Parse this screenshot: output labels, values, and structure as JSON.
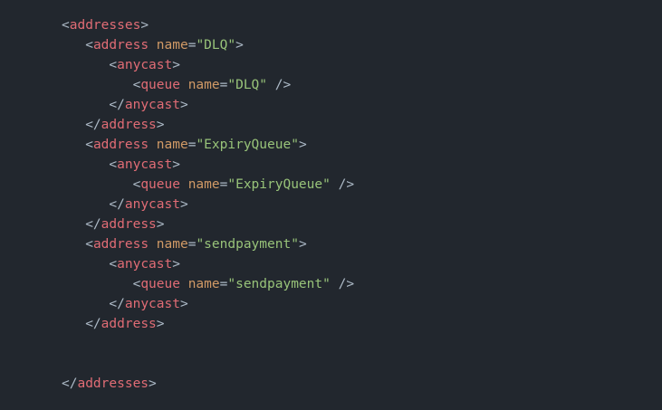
{
  "theme": {
    "background": "#22272e",
    "text": "#adbac7",
    "tag": "#e06c75",
    "attribute": "#d19a66",
    "string": "#98c379"
  },
  "lines": [
    {
      "indent": "",
      "tokens": [
        {
          "t": "<",
          "c": "punct"
        },
        {
          "t": "addresses",
          "c": "tag"
        },
        {
          "t": ">",
          "c": "punct"
        }
      ]
    },
    {
      "indent": "   ",
      "tokens": [
        {
          "t": "<",
          "c": "punct"
        },
        {
          "t": "address",
          "c": "tag"
        },
        {
          "t": " ",
          "c": "punct"
        },
        {
          "t": "name",
          "c": "attr"
        },
        {
          "t": "=",
          "c": "punct"
        },
        {
          "t": "\"DLQ\"",
          "c": "val"
        },
        {
          "t": ">",
          "c": "punct"
        }
      ]
    },
    {
      "indent": "      ",
      "tokens": [
        {
          "t": "<",
          "c": "punct"
        },
        {
          "t": "anycast",
          "c": "tag"
        },
        {
          "t": ">",
          "c": "punct"
        }
      ]
    },
    {
      "indent": "         ",
      "tokens": [
        {
          "t": "<",
          "c": "punct"
        },
        {
          "t": "queue",
          "c": "tag"
        },
        {
          "t": " ",
          "c": "punct"
        },
        {
          "t": "name",
          "c": "attr"
        },
        {
          "t": "=",
          "c": "punct"
        },
        {
          "t": "\"DLQ\"",
          "c": "val"
        },
        {
          "t": " />",
          "c": "punct"
        }
      ]
    },
    {
      "indent": "      ",
      "tokens": [
        {
          "t": "</",
          "c": "punct"
        },
        {
          "t": "anycast",
          "c": "tag"
        },
        {
          "t": ">",
          "c": "punct"
        }
      ]
    },
    {
      "indent": "   ",
      "tokens": [
        {
          "t": "</",
          "c": "punct"
        },
        {
          "t": "address",
          "c": "tag"
        },
        {
          "t": ">",
          "c": "punct"
        }
      ]
    },
    {
      "indent": "   ",
      "tokens": [
        {
          "t": "<",
          "c": "punct"
        },
        {
          "t": "address",
          "c": "tag"
        },
        {
          "t": " ",
          "c": "punct"
        },
        {
          "t": "name",
          "c": "attr"
        },
        {
          "t": "=",
          "c": "punct"
        },
        {
          "t": "\"ExpiryQueue\"",
          "c": "val"
        },
        {
          "t": ">",
          "c": "punct"
        }
      ]
    },
    {
      "indent": "      ",
      "tokens": [
        {
          "t": "<",
          "c": "punct"
        },
        {
          "t": "anycast",
          "c": "tag"
        },
        {
          "t": ">",
          "c": "punct"
        }
      ]
    },
    {
      "indent": "         ",
      "tokens": [
        {
          "t": "<",
          "c": "punct"
        },
        {
          "t": "queue",
          "c": "tag"
        },
        {
          "t": " ",
          "c": "punct"
        },
        {
          "t": "name",
          "c": "attr"
        },
        {
          "t": "=",
          "c": "punct"
        },
        {
          "t": "\"ExpiryQueue\"",
          "c": "val"
        },
        {
          "t": " />",
          "c": "punct"
        }
      ]
    },
    {
      "indent": "      ",
      "tokens": [
        {
          "t": "</",
          "c": "punct"
        },
        {
          "t": "anycast",
          "c": "tag"
        },
        {
          "t": ">",
          "c": "punct"
        }
      ]
    },
    {
      "indent": "   ",
      "tokens": [
        {
          "t": "</",
          "c": "punct"
        },
        {
          "t": "address",
          "c": "tag"
        },
        {
          "t": ">",
          "c": "punct"
        }
      ]
    },
    {
      "indent": "   ",
      "tokens": [
        {
          "t": "<",
          "c": "punct"
        },
        {
          "t": "address",
          "c": "tag"
        },
        {
          "t": " ",
          "c": "punct"
        },
        {
          "t": "name",
          "c": "attr"
        },
        {
          "t": "=",
          "c": "punct"
        },
        {
          "t": "\"sendpayment\"",
          "c": "val"
        },
        {
          "t": ">",
          "c": "punct"
        }
      ]
    },
    {
      "indent": "      ",
      "tokens": [
        {
          "t": "<",
          "c": "punct"
        },
        {
          "t": "anycast",
          "c": "tag"
        },
        {
          "t": ">",
          "c": "punct"
        }
      ]
    },
    {
      "indent": "         ",
      "tokens": [
        {
          "t": "<",
          "c": "punct"
        },
        {
          "t": "queue",
          "c": "tag"
        },
        {
          "t": " ",
          "c": "punct"
        },
        {
          "t": "name",
          "c": "attr"
        },
        {
          "t": "=",
          "c": "punct"
        },
        {
          "t": "\"sendpayment\"",
          "c": "val"
        },
        {
          "t": " />",
          "c": "punct"
        }
      ]
    },
    {
      "indent": "      ",
      "tokens": [
        {
          "t": "</",
          "c": "punct"
        },
        {
          "t": "anycast",
          "c": "tag"
        },
        {
          "t": ">",
          "c": "punct"
        }
      ]
    },
    {
      "indent": "   ",
      "tokens": [
        {
          "t": "</",
          "c": "punct"
        },
        {
          "t": "address",
          "c": "tag"
        },
        {
          "t": ">",
          "c": "punct"
        }
      ]
    },
    {
      "indent": "",
      "tokens": []
    },
    {
      "indent": "",
      "tokens": []
    },
    {
      "indent": "",
      "tokens": [
        {
          "t": "</",
          "c": "punct"
        },
        {
          "t": "addresses",
          "c": "tag"
        },
        {
          "t": ">",
          "c": "punct"
        }
      ]
    }
  ]
}
